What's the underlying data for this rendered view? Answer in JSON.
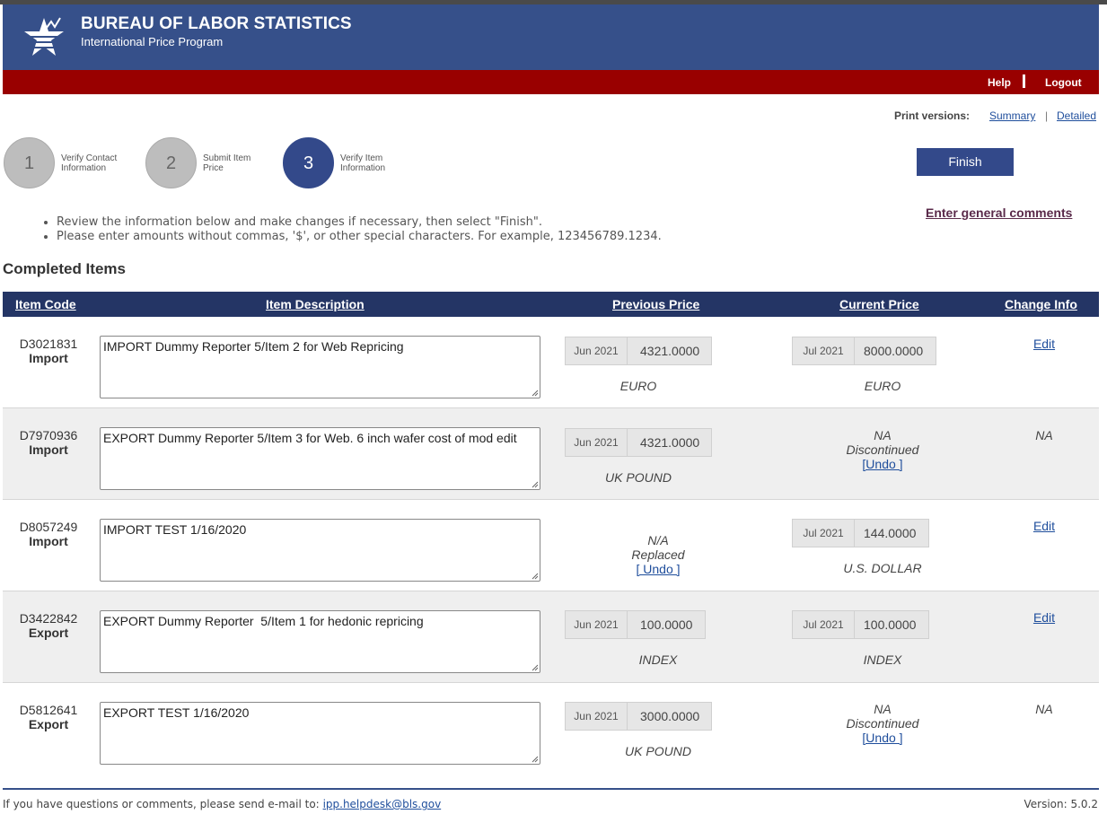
{
  "header": {
    "title": "BUREAU OF LABOR STATISTICS",
    "subtitle": "International Price Program"
  },
  "nav": {
    "help": "Help",
    "logout": "Logout"
  },
  "print_versions": {
    "label": "Print versions:",
    "summary": "Summary",
    "detailed": "Detailed"
  },
  "steps": [
    {
      "number": "1",
      "label": "Verify Contact Information"
    },
    {
      "number": "2",
      "label": "Submit Item Price"
    },
    {
      "number": "3",
      "label": "Verify Item Information"
    }
  ],
  "finish_label": "Finish",
  "general_comments_label": "Enter general comments",
  "instructions": [
    "Review the information below and make changes if necessary, then select \"Finish\".",
    "Please enter amounts without commas, '$', or other special characters. For example, 123456789.1234."
  ],
  "section_title": "Completed Items",
  "table": {
    "columns": [
      "Item Code",
      "Item Description",
      "Previous Price",
      "Current Price",
      "Change Info"
    ],
    "rows": [
      {
        "code": "D3021831",
        "type": "Import",
        "description": "IMPORT Dummy Reporter 5/Item 2 for Web Repricing",
        "prev_month": "Jun 2021",
        "prev_value": "4321.0000",
        "prev_currency": "EURO",
        "cur_month": "Jul 2021",
        "cur_value": "8000.0000",
        "cur_currency": "EURO",
        "change": "Edit"
      },
      {
        "code": "D7970936",
        "type": "Import",
        "description": "EXPORT Dummy Reporter 5/Item 3 for Web. 6 inch wafer cost of mod edit",
        "prev_month": "Jun 2021",
        "prev_value": "4321.0000",
        "prev_currency": "UK POUND",
        "cur_na": "NA",
        "cur_status": "Discontinued",
        "cur_undo": "[Undo ]",
        "change": "NA"
      },
      {
        "code": "D8057249",
        "type": "Import",
        "description": "IMPORT TEST 1/16/2020",
        "prev_na": "N/A",
        "prev_status": "Replaced",
        "prev_undo": "[ Undo ]",
        "cur_month": "Jul 2021",
        "cur_value": "144.0000",
        "cur_currency": "U.S. DOLLAR",
        "change": "Edit"
      },
      {
        "code": "D3422842",
        "type": "Export",
        "description": "EXPORT Dummy Reporter  5/Item 1 for hedonic repricing",
        "prev_month": "Jun 2021",
        "prev_value": "100.0000",
        "prev_currency": "INDEX",
        "cur_month": "Jul 2021",
        "cur_value": "100.0000",
        "cur_currency": "INDEX",
        "change": "Edit"
      },
      {
        "code": "D5812641",
        "type": "Export",
        "description": "EXPORT TEST 1/16/2020",
        "prev_month": "Jun 2021",
        "prev_value": "3000.0000",
        "prev_currency": "UK POUND",
        "cur_na": "NA",
        "cur_status": "Discontinued",
        "cur_undo": "[Undo ]",
        "change": "NA"
      }
    ]
  },
  "footer": {
    "text": "If you have questions or comments, please send e-mail to:",
    "email": "ipp.helpdesk@bls.gov",
    "version": "Version: 5.0.2"
  },
  "colors": {
    "banner": "#36508a",
    "redbar": "#990000",
    "table_header": "#243565",
    "active_step": "#33498a"
  }
}
